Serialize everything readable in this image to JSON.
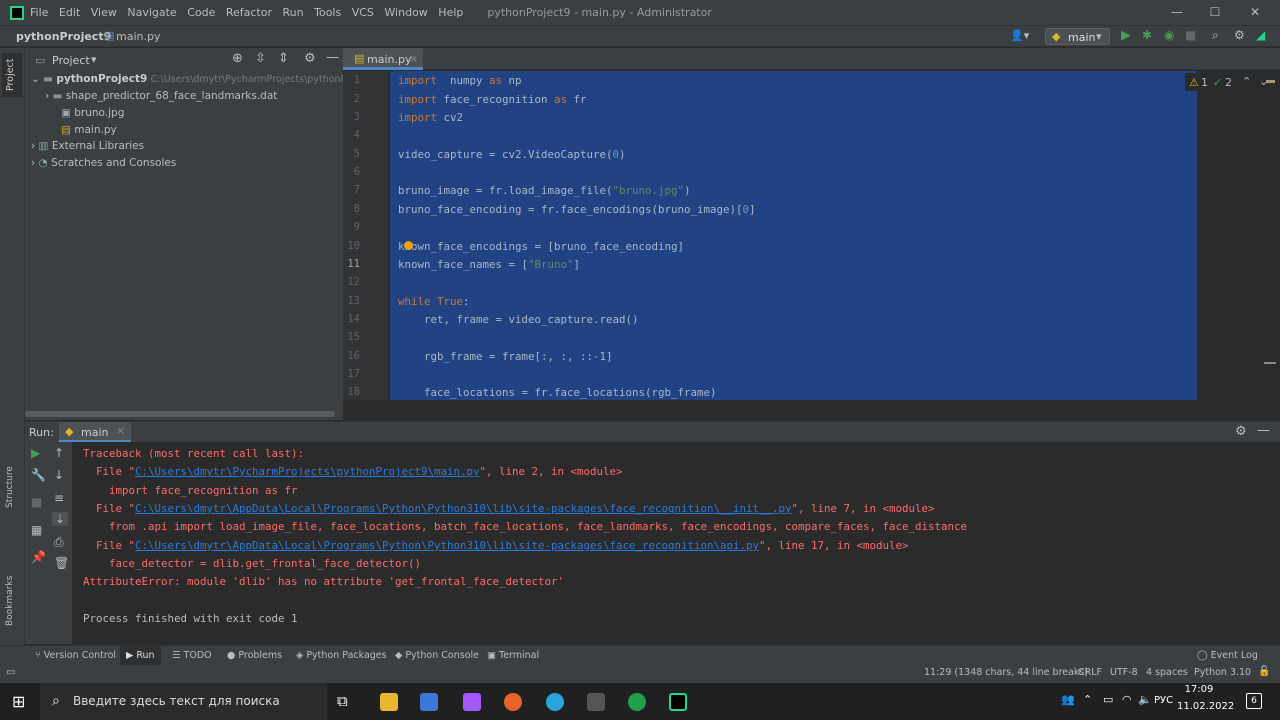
{
  "title_bar": {
    "menu": [
      "File",
      "Edit",
      "View",
      "Navigate",
      "Code",
      "Refactor",
      "Run",
      "Tools",
      "VCS",
      "Window",
      "Help"
    ],
    "window_title": "pythonProject9 - main.py - Administrator",
    "controls": {
      "minimize": "—",
      "maximize": "☐",
      "close": "✕"
    }
  },
  "nav_bar": {
    "project": "pythonProject9",
    "file": "main.py",
    "run_config": "main"
  },
  "project_panel": {
    "title": "Project",
    "root": "pythonProject9",
    "root_path": "C:\\Users\\dmytr\\PycharmProjects\\pythonProject",
    "items": [
      {
        "label": "shape_predictor_68_face_landmarks.dat",
        "icon": "folder-icon"
      },
      {
        "label": "bruno.jpg",
        "icon": "image-file-icon"
      },
      {
        "label": "main.py",
        "icon": "python-file-icon"
      },
      {
        "label": "External Libraries",
        "icon": "library-icon"
      },
      {
        "label": "Scratches and Consoles",
        "icon": "scratches-icon"
      }
    ]
  },
  "side_strip": {
    "project": "Project",
    "structure": "Structure",
    "bookmarks": "Bookmarks"
  },
  "editor": {
    "tab": "main.py",
    "warnings": "1",
    "weak_warnings": "2",
    "line_numbers": [
      "1",
      "2",
      "3",
      "4",
      "5",
      "6",
      "7",
      "8",
      "9",
      "10",
      "11",
      "12",
      "13",
      "14",
      "15",
      "16",
      "17",
      "18"
    ]
  },
  "run_panel": {
    "label": "Run:",
    "config": "main",
    "output": {
      "l1": "Traceback (most recent call last):",
      "l2_pre": "  File \"",
      "l2_link": "C:\\Users\\dmytr\\PycharmProjects\\pythonProject9\\main.py",
      "l2_post": "\", line 2, in <module>",
      "l3": "    import face_recognition as fr",
      "l4_pre": "  File \"",
      "l4_link": "C:\\Users\\dmytr\\AppData\\Local\\Programs\\Python\\Python310\\lib\\site-packages\\face_recognition\\__init__.py",
      "l4_post": "\", line 7, in <module>",
      "l5": "    from .api import load_image_file, face_locations, batch_face_locations, face_landmarks, face_encodings, compare_faces, face_distance",
      "l6_pre": "  File \"",
      "l6_link": "C:\\Users\\dmytr\\AppData\\Local\\Programs\\Python\\Python310\\lib\\site-packages\\face_recognition\\api.py",
      "l6_post": "\", line 17, in <module>",
      "l7": "    face_detector = dlib.get_frontal_face_detector()",
      "l8": "AttributeError: module 'dlib' has no attribute 'get_frontal_face_detector'",
      "l9": "Process finished with exit code 1"
    }
  },
  "bottom_tabs": [
    "Version Control",
    "Run",
    "TODO",
    "Problems",
    "Python Packages",
    "Python Console",
    "Terminal"
  ],
  "event_log": "Event Log",
  "status_bar": {
    "position": "11:29 (1348 chars, 44 line breaks)",
    "line_sep": "CRLF",
    "encoding": "UTF-8",
    "indent": "4 spaces",
    "interpreter": "Python 3.10"
  },
  "taskbar": {
    "search_placeholder": "Введите здесь текст для поиска",
    "lang": "РУС",
    "time": "17:09",
    "date": "11.02.2022",
    "notifications": "6"
  },
  "colors": {
    "accent": "#214283",
    "error": "#ff6b68",
    "link": "#287bde",
    "keyword": "#cc7832",
    "string": "#6a8759"
  }
}
